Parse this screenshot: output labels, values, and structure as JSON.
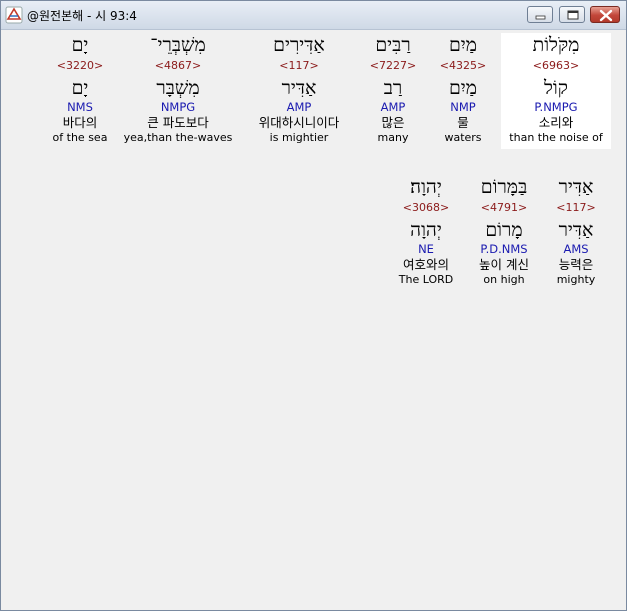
{
  "window": {
    "title": "@원전본해 - 시 93:4"
  },
  "rows": [
    [
      {
        "word": "מִקֹּלוֹת",
        "strong": "<6963>",
        "lemma": "קוֹל",
        "morph": "P.NMPG",
        "kor": "소리와",
        "eng": "than the noise of",
        "selected": true
      },
      {
        "word": "מַיִם",
        "strong": "<4325>",
        "lemma": "מַיִם",
        "morph": "NMP",
        "kor": "물",
        "eng": "waters",
        "selected": false
      },
      {
        "word": "רַבִּים",
        "strong": "<7227>",
        "lemma": "רַב",
        "morph": "AMP",
        "kor": "많은",
        "eng": "many",
        "selected": false
      },
      {
        "word": "אַדִּירִים",
        "strong": "<117>",
        "lemma": "אַדִּיר",
        "morph": "AMP",
        "kor": "위대하시니이다",
        "eng": "is mightier",
        "selected": false
      },
      {
        "word": "מִשְׁבְּרֵי־",
        "strong": "<4867>",
        "lemma": "מִשְׁבָּר",
        "morph": "NMPG",
        "kor": "큰 파도보다",
        "eng": "yea,than the-waves",
        "selected": false
      },
      {
        "word": "יָם",
        "strong": "<3220>",
        "lemma": "יָם",
        "morph": "NMS",
        "kor": "바다의",
        "eng": "of the sea",
        "selected": false
      }
    ],
    [
      {
        "word": "אַדִּיר",
        "strong": "<117>",
        "lemma": "אַדִּיר",
        "morph": "AMS",
        "kor": "능력은",
        "eng": "mighty",
        "selected": false
      },
      {
        "word": "בַּמָּרוֹם",
        "strong": "<4791>",
        "lemma": "מָרוֹם",
        "morph": "P.D.NMS",
        "kor": "높이 계신",
        "eng": "on high",
        "selected": false
      },
      {
        "word": "יְהוָה׃",
        "strong": "<3068>",
        "lemma": "יְהוָה",
        "morph": "NE",
        "kor": "여호와의",
        "eng": "The LORD",
        "selected": false
      }
    ]
  ]
}
